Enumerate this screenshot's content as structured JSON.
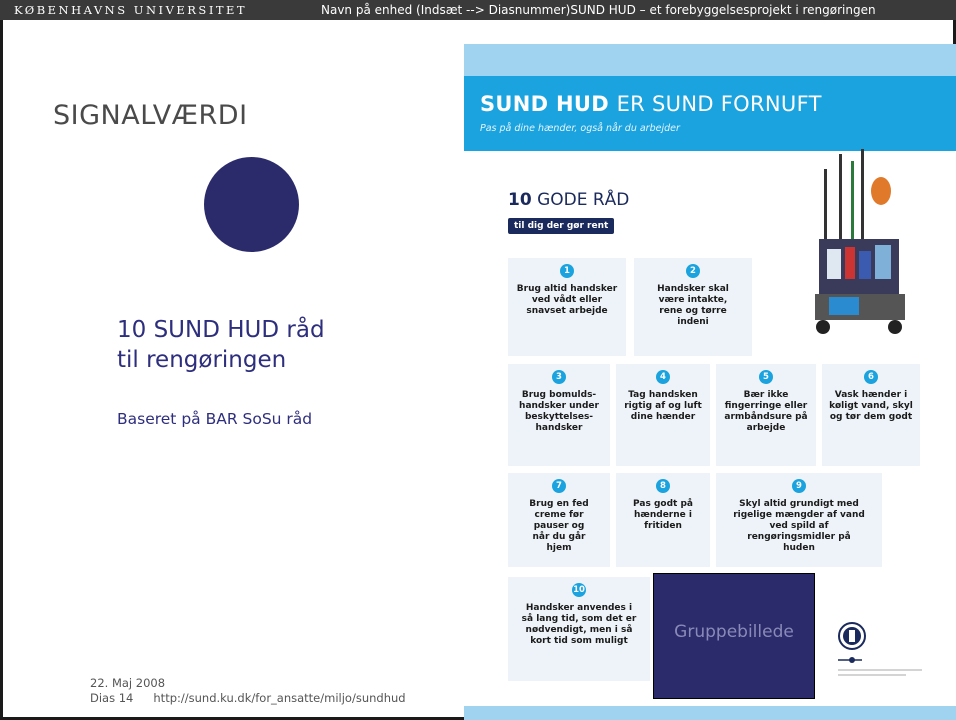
{
  "header": {
    "university": "KØBENHAVNS UNIVERSITET",
    "subtitle": "Navn på enhed  (Indsæt --> Diasnummer)SUND HUD – et forebyggelsesprojekt i rengøringen"
  },
  "slide": {
    "title": "SIGNALVÆRDI",
    "heading_line1": "10 SUND HUD råd",
    "heading_line2": "til rengøringen",
    "subtext": "Baseret på BAR SoSu råd",
    "date": "22. Maj 2008",
    "slide_number": "Dias 14",
    "url": "http://sund.ku.dk/for_ansatte/miljo/sundhud"
  },
  "poster": {
    "title_bold": "SUND HUD",
    "title_light": "ER SUND FORNUFT",
    "subtitle": "Pas på dine hænder, også når du arbejder",
    "raad_number": "10",
    "raad_label": "GODE RÅD",
    "pill": "til dig der gør rent",
    "placeholder": "Gruppebillede",
    "tips": [
      {
        "n": "1",
        "text": "Brug altid handsker ved vådt eller snavset arbejde"
      },
      {
        "n": "2",
        "text": "Handsker skal være intakte, rene og tørre indeni"
      },
      {
        "n": "3",
        "text": "Brug bomulds-handsker under beskyttelses-handsker"
      },
      {
        "n": "4",
        "text": "Tag handsken rigtig af og luft dine hænder"
      },
      {
        "n": "5",
        "text": "Bær ikke fingerringe eller armbåndsure på arbejde"
      },
      {
        "n": "6",
        "text": "Vask hænder i køligt vand, skyl og tør dem godt"
      },
      {
        "n": "7",
        "text": "Brug en fed creme før pauser og når du går hjem"
      },
      {
        "n": "8",
        "text": "Pas godt på hænderne i fritiden"
      },
      {
        "n": "9",
        "text": "Skyl altid grundigt med rigelige mængder af vand ved spild af rengøringsmidler på huden"
      },
      {
        "n": "10",
        "text": "Handsker anvendes i så lang tid, som det er nødvendigt, men i så kort tid som muligt"
      }
    ]
  },
  "colors": {
    "header_bg": "#3a3a3a",
    "title_text": "#4a4a4a",
    "accent_navy": "#2b2b6b",
    "heading_text": "#2e2e7e",
    "poster_blue": "#1aa3de",
    "poster_light_blue": "#9fd3ef",
    "tip_bg": "#edf3f8"
  }
}
